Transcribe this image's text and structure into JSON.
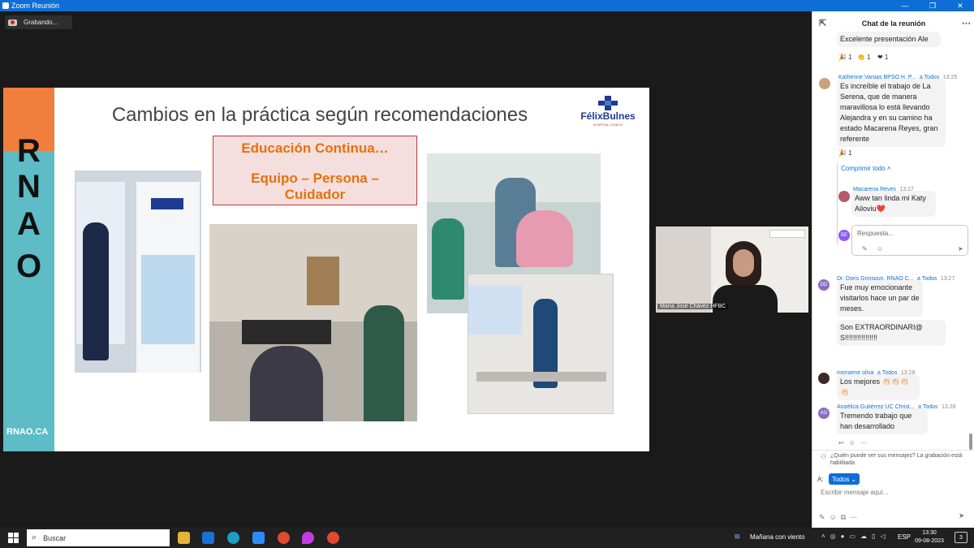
{
  "window": {
    "title": "Zoom Reunión"
  },
  "recording": {
    "label": "Grabando..."
  },
  "slide": {
    "brand_letters": [
      "R",
      "N",
      "A",
      "O"
    ],
    "brand_site": "RNAO.CA",
    "title": "Cambios en la práctica según recomendaciones",
    "logo_text": "FélixBulnes",
    "logo_subtext": "HOSPITAL CLÍNICO",
    "box_line1": "Educación Continua…",
    "box_line2": "Equipo – Persona –",
    "box_line3": "Cuidador"
  },
  "video": {
    "participant_name": "María José Chávez HFBC"
  },
  "chat": {
    "title": "Chat de la reunión",
    "messages": [
      {
        "text": "Excelente presentación Ale",
        "reactions": [
          "🎉 1",
          "👏 1",
          "❤ 1"
        ]
      },
      {
        "sender": "Katherine Vargas BPSO H. P...",
        "to": "a Todos",
        "time": "13:25",
        "text": "Es increíble el trabajo de La Serena, que de manera maravillosa lo está llevando Alejandra y en su camino ha estado Macarena Reyes, gran referente",
        "reactions": [
          "🎉 1"
        ]
      },
      {
        "collapse": "Comprimir todo"
      },
      {
        "sender": "Macarena Reyes",
        "time": "13:27",
        "text": "Aww tan linda mi Katy Ailoviu❤️"
      },
      {
        "reply_placeholder": "Respuesta..."
      },
      {
        "sender": "Dr. Doris Grinspun, RNAO C...",
        "to": "a Todos",
        "time": "13:27",
        "initials": "DD",
        "text": "Fue muy emocionante visitarlos hace un par de meses.",
        "text2": "Son EXTRAORDINARI@S!!!!!!!!!!!!!!!!"
      },
      {
        "sender": "merigene oliva",
        "to": "a Todos",
        "time": "13:28",
        "text": "Los mejores 👏🏻👏🏻👏🏻👏🏻"
      },
      {
        "sender": "Angélica Gutiérrez UC Christ...",
        "to": "a Todos",
        "time": "13:28",
        "initials": "AG",
        "text": "Tremendo trabajo que han desarrollado"
      }
    ],
    "notice": "¿Quién puede ver sus mensajes? La grabación está habilitada",
    "to_label": "A:",
    "to_value": "Todos",
    "input_placeholder": "Escribir mensaje aquí..."
  },
  "taskbar": {
    "search": "Buscar",
    "weather": "Mañana con viento",
    "lang": "ESP",
    "time": "13:30",
    "date": "09-08-2023",
    "notif_count": "3"
  }
}
